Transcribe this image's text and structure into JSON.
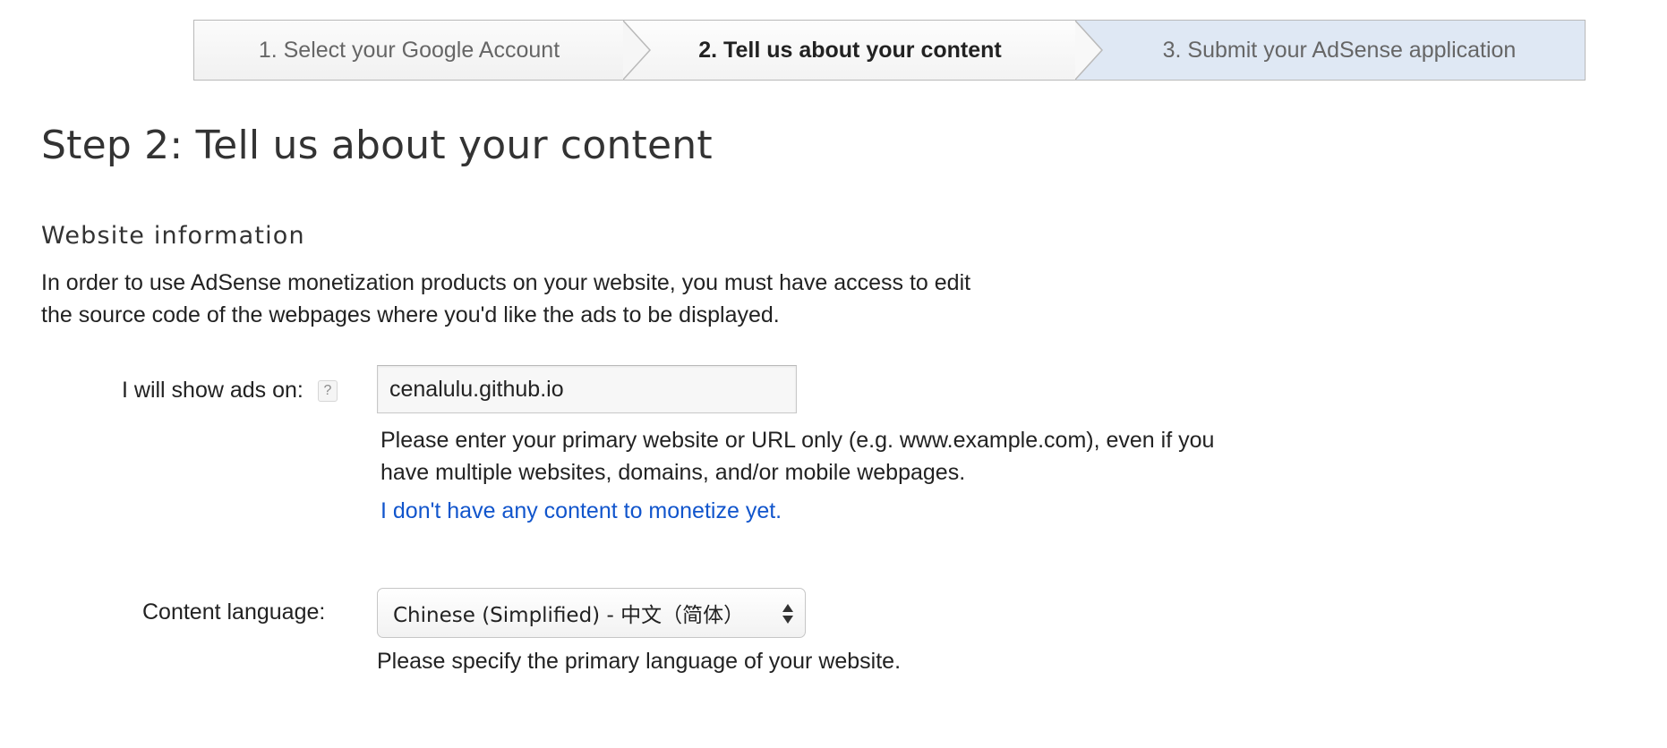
{
  "wizard": {
    "steps": [
      {
        "label": "1. Select your Google Account",
        "state": "done"
      },
      {
        "label": "2. Tell us about your content",
        "state": "current"
      },
      {
        "label": "3. Submit your AdSense application",
        "state": "upcoming"
      }
    ]
  },
  "page": {
    "title": "Step 2: Tell us about your content"
  },
  "website_info": {
    "heading": "Website information",
    "intro_line1": "In order to use AdSense monetization products on your website, you must have access to edit",
    "intro_line2": "the source code of the webpages where you'd like the ads to be displayed."
  },
  "site_field": {
    "label": "I will show ads on:",
    "help_glyph": "?",
    "value": "cenalulu.github.io",
    "hint_line1": "Please enter your primary website or URL only (e.g. www.example.com), even if you",
    "hint_line2": "have multiple websites, domains, and/or mobile webpages.",
    "no_content_link": "I don't have any content to monetize yet."
  },
  "language_field": {
    "label": "Content language:",
    "selected": "Chinese (Simplified) - 中文（简体）",
    "hint": "Please specify the primary language of your website."
  },
  "colors": {
    "link": "#1155cc",
    "upcoming_step_bg": "#dfe8f4",
    "text": "#222222",
    "heading": "#333333"
  },
  "icons": {
    "help": "question-mark-icon",
    "select_arrows": "up-down-arrows-icon",
    "step_separator": "chevron-right-icon"
  }
}
